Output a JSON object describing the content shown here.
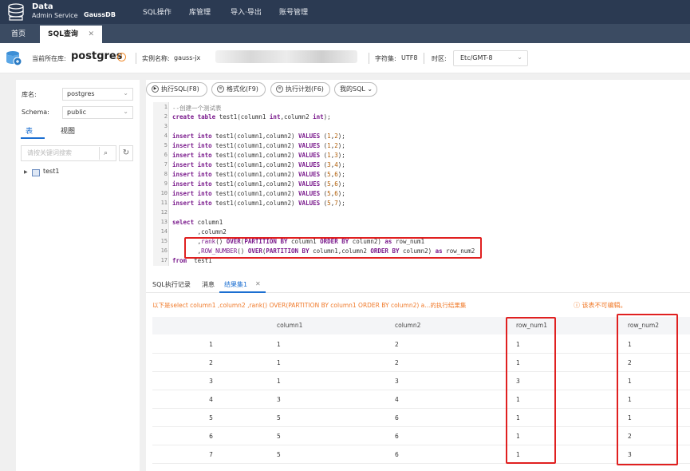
{
  "app": {
    "brand_line1": "Data",
    "brand_line2": "Admin Service",
    "brand_product": "GaussDB"
  },
  "nav": [
    "SQL操作",
    "库管理",
    "导入·导出",
    "账号管理"
  ],
  "tabs": {
    "home": "首页",
    "sql": "SQL查询",
    "close": "✕"
  },
  "info": {
    "current_db_label": "当前所在库:",
    "current_db": "postgres",
    "instance_label": "实例名称:",
    "instance": "gauss-jx",
    "charset_label": "字符集:",
    "charset": "UTF8",
    "timezone_label": "时区:",
    "timezone": "Etc/GMT-8"
  },
  "left": {
    "db_label": "库名:",
    "db_value": "postgres",
    "schema_label": "Schema:",
    "schema_value": "public",
    "tab_tables": "表",
    "tab_views": "视图",
    "search_placeholder": "请按关键词搜索",
    "tree_item": "test1"
  },
  "toolbar": {
    "run": "执行SQL(F8)",
    "format": "格式化(F9)",
    "plan": "执行计划(F6)",
    "my_sql": "我的SQL"
  },
  "editor": {
    "line_numbers": [
      "1",
      "2",
      "3",
      "4",
      "5",
      "6",
      "7",
      "8",
      "9",
      "10",
      "11",
      "12",
      "13",
      "14",
      "15",
      "16",
      "17"
    ]
  },
  "results": {
    "tab_history": "SQL执行记录",
    "tab_messages": "消息",
    "tab_result": "结果集1",
    "note": "以下是select column1 ,column2 ,rank() OVER(PARTITION BY column1 ORDER BY column2) a...的执行结果集",
    "readonly_note": "ⓘ 该表不可编辑。",
    "columns": [
      "",
      "column1",
      "column2",
      "row_num1",
      "row_num2"
    ],
    "rows": [
      [
        "1",
        "1",
        "2",
        "1",
        "1"
      ],
      [
        "2",
        "1",
        "2",
        "1",
        "2"
      ],
      [
        "3",
        "1",
        "3",
        "3",
        "1"
      ],
      [
        "4",
        "3",
        "4",
        "1",
        "1"
      ],
      [
        "5",
        "5",
        "6",
        "1",
        "1"
      ],
      [
        "6",
        "5",
        "6",
        "1",
        "2"
      ],
      [
        "7",
        "5",
        "6",
        "1",
        "3"
      ]
    ]
  },
  "colors": {
    "topbar": "#2b3a52",
    "accent": "#1c6fd1",
    "highlight": "#e02020",
    "warning": "#f07a2a"
  }
}
